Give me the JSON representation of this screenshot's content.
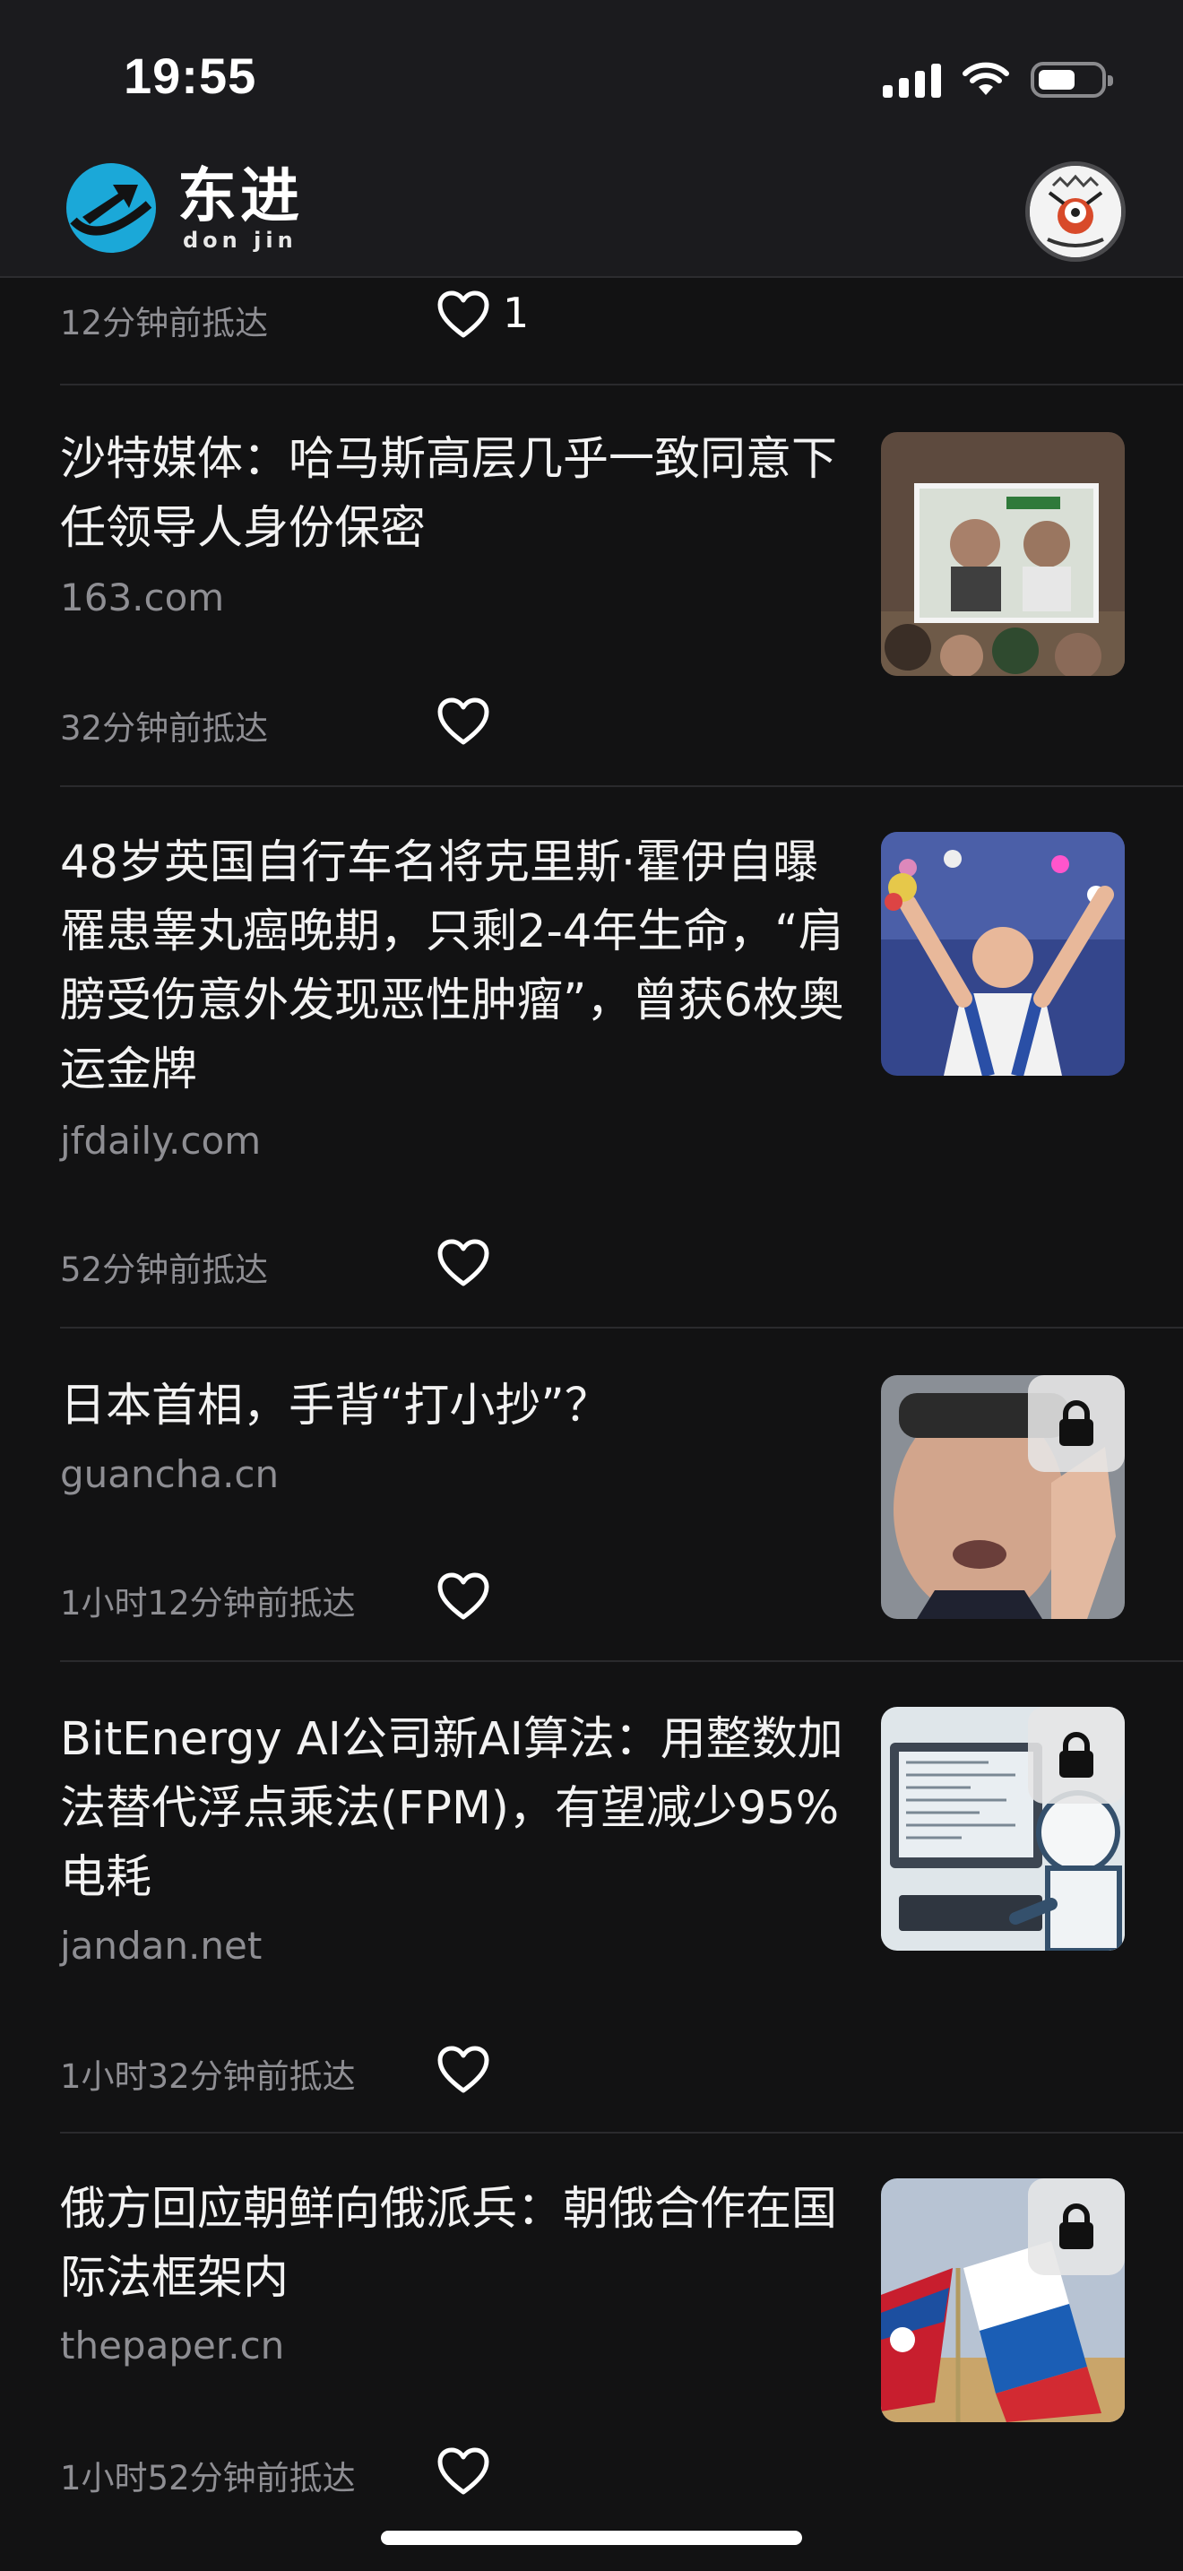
{
  "status_bar": {
    "time": "19:55"
  },
  "header": {
    "brand_cn": "东进",
    "brand_en": "don jin",
    "colors": {
      "logo": "#1ba8d8",
      "background": "#1b1b1e"
    }
  },
  "top_partial_item": {
    "time": "12分钟前抵达",
    "likes": "1"
  },
  "articles": [
    {
      "title": "沙特媒体：哈马斯高层几乎一致同意下任领导人身份保密",
      "source": "163.com",
      "time": "32分钟前抵达",
      "locked": false,
      "thumb_icon": "protest-photo"
    },
    {
      "title": "48岁英国自行车名将克里斯·霍伊自曝罹患睾丸癌晚期，只剩2-4年生命，“肩膀受伤意外发现恶性肿瘤”，曾获6枚奥运金牌",
      "source": "jfdaily.com",
      "time": "52分钟前抵达",
      "locked": false,
      "thumb_icon": "athlete-photo"
    },
    {
      "title": "日本首相，手背“打小抄”？",
      "source": "guancha.cn",
      "time": "1小时12分钟前抵达",
      "locked": true,
      "thumb_icon": "politician-photo"
    },
    {
      "title": "BitEnergy AI公司新AI算法：用整数加法替代浮点乘法(FPM)，有望减少95%电耗",
      "source": "jandan.net",
      "time": "1小时32分钟前抵达",
      "locked": true,
      "thumb_icon": "robot-computer-illustration"
    },
    {
      "title": "俄方回应朝鲜向俄派兵：朝俄合作在国际法框架内",
      "source": "thepaper.cn",
      "time": "1小时52分钟前抵达",
      "locked": true,
      "thumb_icon": "flags-photo"
    }
  ]
}
